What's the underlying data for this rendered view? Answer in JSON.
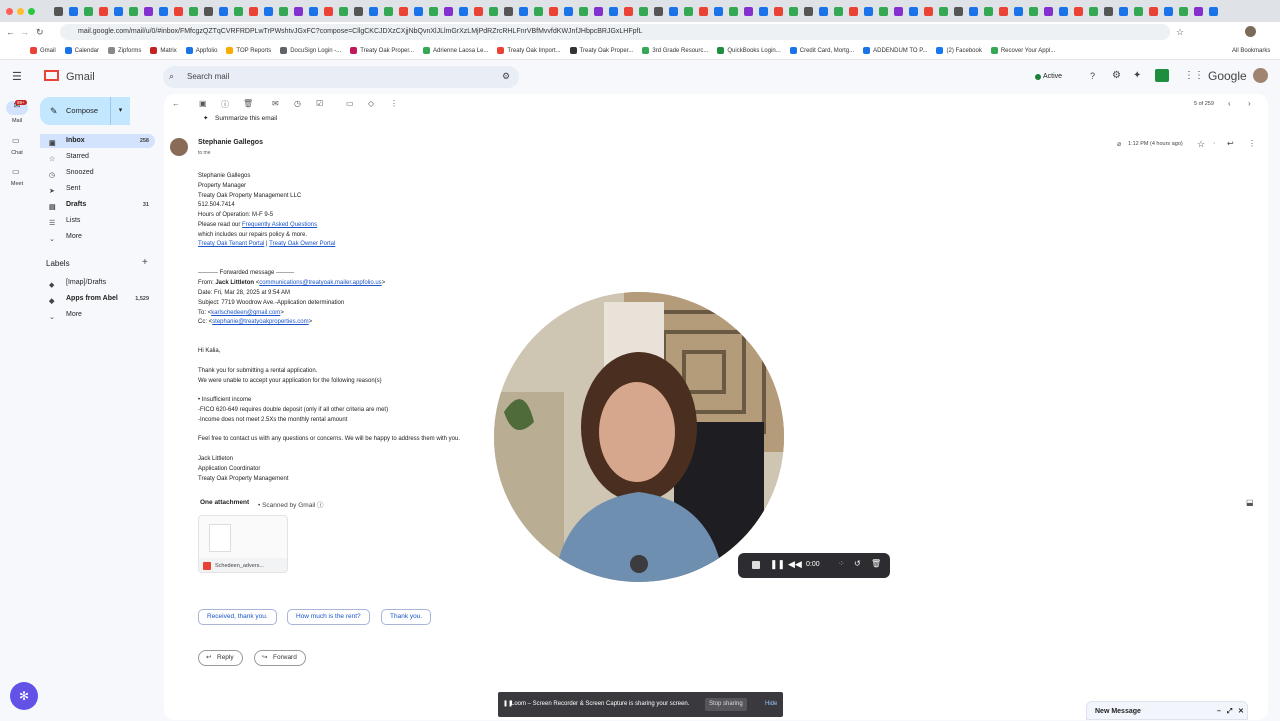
{
  "browser": {
    "url": "mail.google.com/mail/u/0/#inbox/FMfcgzQZTqCVRFRDPLwTrPWshtvJGxFC?compose=CllgCKCJDXzCXjjNbQvnXlJLlmGrXzLMjPdRZrcRHLFnrVBfMvvfdKWJnfJHbpcBRJGxLHFpfL",
    "bookmarks": [
      "Gmail",
      "Calendar",
      "Zipforms",
      "Matrix",
      "Appfolio",
      "TOP Reports",
      "DocuSign Login -...",
      "Treaty Oak Proper...",
      "Adrienne Laosa Le...",
      "Treaty Oak Import...",
      "Treaty Oak Proper...",
      "3rd Grade Resourc...",
      "QuickBooks Login...",
      "Credit Card, Mortg...",
      "ADDENDUM TO P...",
      "(2) Facebook",
      "Recover Your Appl..."
    ],
    "all_bookmarks": "All Bookmarks"
  },
  "gmail": {
    "logo": "Gmail",
    "search_placeholder": "Search mail",
    "status": "Active",
    "google": "Google",
    "rail": {
      "mail": "Mail",
      "mail_badge": "99+",
      "chat": "Chat",
      "meet": "Meet"
    },
    "compose": "Compose",
    "nav": [
      {
        "label": "Inbox",
        "count": "258",
        "icon": "inbox-icon",
        "glyph": "▣"
      },
      {
        "label": "Starred",
        "count": "",
        "icon": "star-icon",
        "glyph": "☆"
      },
      {
        "label": "Snoozed",
        "count": "",
        "icon": "clock-icon",
        "glyph": "◷"
      },
      {
        "label": "Sent",
        "count": "",
        "icon": "send-icon",
        "glyph": "➤"
      },
      {
        "label": "Drafts",
        "count": "31",
        "icon": "draft-icon",
        "glyph": "▤"
      },
      {
        "label": "Lists",
        "count": "",
        "icon": "list-icon",
        "glyph": "☰"
      },
      {
        "label": "More",
        "count": "",
        "icon": "chevron-down-icon",
        "glyph": "⌄"
      }
    ],
    "labels_title": "Labels",
    "labels": [
      {
        "label": "[Imap]/Drafts",
        "count": ""
      },
      {
        "label": "Apps from Abel",
        "count": "1,529"
      },
      {
        "label": "More",
        "count": ""
      }
    ],
    "pagination": "5 of 259"
  },
  "email": {
    "summarize": "Summarize this email",
    "sender": "Stephanie Gallegos",
    "to_me": "to me",
    "time": "1:12 PM (4 hours ago)",
    "signature": [
      "Stephanie Gallegos",
      "Property Manager",
      "Treaty Oak Property Management LLC",
      "512.504.7414",
      "Hours of Operation: M-F 9-5"
    ],
    "faq_prefix": "Please read our ",
    "faq_link": "Frequently Asked Questions",
    "faq_suffix": "which includes our repairs policy & more.",
    "tenant_portal": "Treaty Oak Tenant Portal",
    "owner_portal": "Treaty Oak Owner Portal",
    "forwarded": "---------- Forwarded message ---------",
    "from_label": "From:",
    "from_name": "Jack Littleton",
    "from_email": "communications@treatyoak.mailer.appfolio.us",
    "date": "Date: Fri, Mar 28, 2025 at 9:54 AM",
    "subject": "Subject: 7719 Woodrow Ave.-Application determination",
    "to_label": "To:",
    "to_email": "karlschedeen@gmail.com",
    "cc_label": "Cc:",
    "cc_email": "stephanie@treatyoakproperties.com",
    "greeting": "Hi Kalia,",
    "body1": "Thank you for submitting a rental application.",
    "body2": "We were unable to accept your application for the following reason(s)",
    "reasons": [
      "• Insufficient income",
      "-FICO 620-649 requires double deposit (only if all other criteria are met)",
      "-Income does not meet 2.5Xs the monthly rental amount"
    ],
    "closing": "Feel free to contact us with any questions or concerns. We will be happy to address them with you.",
    "footer": [
      "Jack Littleton",
      "Application Coordinator",
      "Treaty Oak Property Management"
    ],
    "attachment_title": "One attachment",
    "scanned": "Scanned by Gmail",
    "attachment_name": "Schedeen_advers...",
    "smart_replies": [
      "Received, thank you.",
      "How much is the rent?",
      "Thank you."
    ],
    "reply": "Reply",
    "forward": "Forward"
  },
  "loom": {
    "timer": "0:00",
    "sharing_text": "Loom – Screen Recorder & Screen Capture is sharing your screen.",
    "stop": "Stop sharing",
    "hide": "Hide"
  },
  "new_message": "New Message",
  "colors": {
    "compose_bg": "#c2e7ff",
    "inbox_active": "#d3e3fd",
    "link": "#1a55c9",
    "gmail_red": "#ea4335"
  }
}
